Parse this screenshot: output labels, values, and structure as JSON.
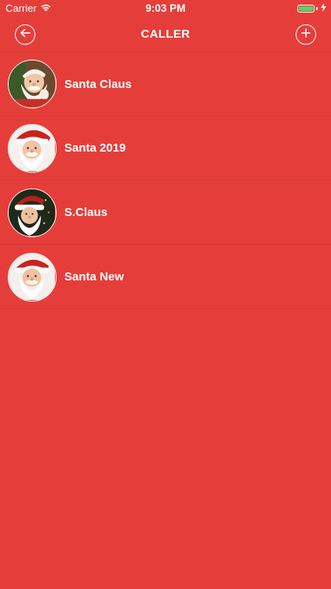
{
  "status_bar": {
    "carrier": "Carrier",
    "time": "9:03 PM",
    "battery_color": "#4cd964"
  },
  "nav": {
    "title": "CALLER",
    "back_icon": "arrow-left-icon",
    "add_icon": "plus-icon"
  },
  "theme": {
    "background": "#e53e3a",
    "text": "#ffffff"
  },
  "callers": [
    {
      "name": "Santa Claus",
      "avatar": "santa-photo-1"
    },
    {
      "name": "Santa 2019",
      "avatar": "santa-photo-2"
    },
    {
      "name": "S.Claus",
      "avatar": "santa-photo-3"
    },
    {
      "name": "Santa New",
      "avatar": "santa-photo-4"
    }
  ]
}
